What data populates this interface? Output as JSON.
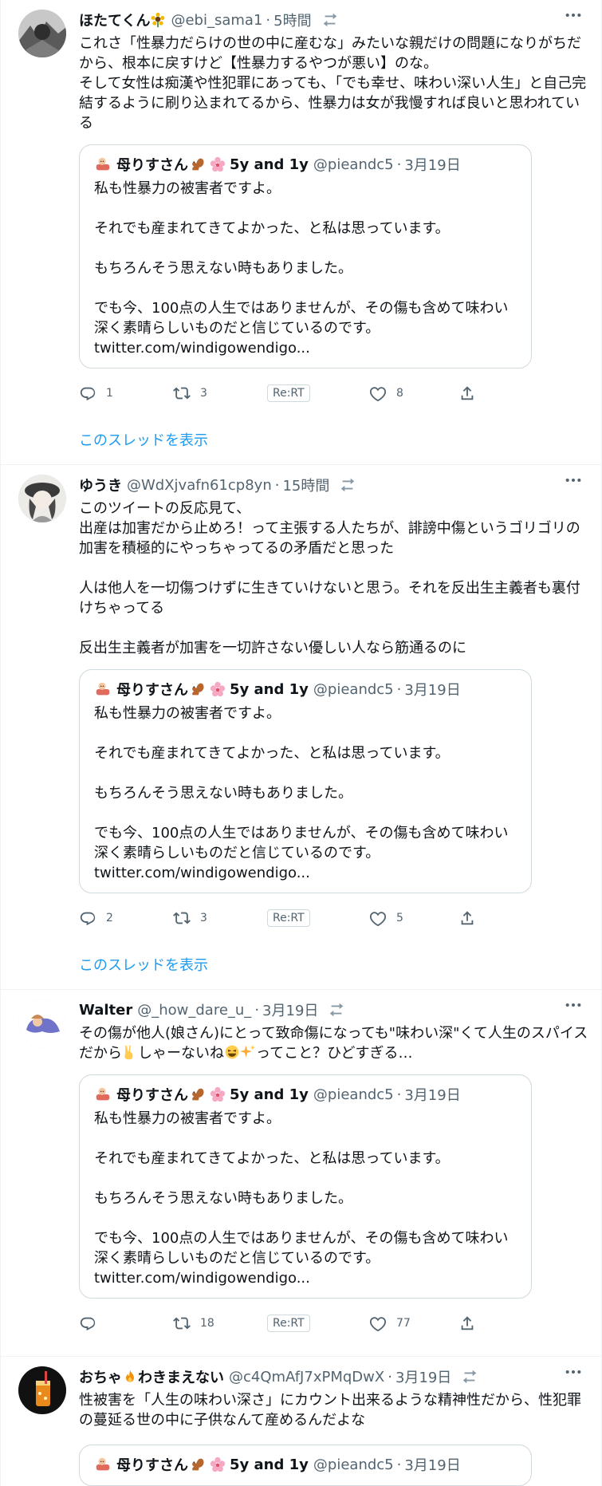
{
  "quote": {
    "name": "母りすさん",
    "tag": "5y and 1y",
    "handle": "@pieandc5",
    "time": "3月19日",
    "body": "私も性暴力の被害者ですよ。\n\nそれでも産まれてきてよかった、と私は思っています。\n\nもちろんそう思えない時もありました。\n\nでも今、100点の人生ではありませんが、その傷も含めて味わい深く素晴らしいものだと信じているのです。 ",
    "link": "twitter.com/windigowendigo..."
  },
  "labels": {
    "rert": "Re:RT",
    "show_thread": "このスレッドを表示",
    "dot": "·"
  },
  "tweets": [
    {
      "name": "ほたてくん",
      "handle": "@ebi_sama1",
      "time": "5時間",
      "body": "これさ「性暴力だらけの世の中に産むな」みたいな親だけの問題になりがちだから、根本に戻すけど【性暴力するやつが悪い】のな。\nそして女性は痴漢や性犯罪にあっても、「でも幸せ、味わい深い人生」と自己完結するように刷り込まれてるから、性暴力は女が我慢すれば良いと思われている",
      "replies": "1",
      "retweets": "3",
      "likes": "8"
    },
    {
      "name": "ゆうき",
      "handle": "@WdXjvafn61cp8yn",
      "time": "15時間",
      "body": "このツイートの反応見て、\n出産は加害だから止めろ！って主張する人たちが、誹謗中傷というゴリゴリの加害を積極的にやっちゃってるの矛盾だと思った\n\n人は他人を一切傷つけずに生きていけないと思う。それを反出生主義者も裏付けちゃってる\n\n反出生主義者が加害を一切許さない優しい人なら筋通るのに",
      "replies": "2",
      "retweets": "3",
      "likes": "5"
    },
    {
      "name": "Walter",
      "handle": "@_how_dare_u_",
      "time": "3月19日",
      "body_a": "その傷が他人(娘さん)にとって致命傷になっても\"味わい深\"くて人生のスパイスだから",
      "body_b": "しゃーないね",
      "body_c": "ってこと？ひどすぎる…",
      "replies": "",
      "retweets": "18",
      "likes": "77"
    },
    {
      "name_a": "おちゃ",
      "name_b": "わきまえない",
      "handle": "@c4QmAfJ7xPMqDwX",
      "time": "3月19日",
      "body": "性被害を「人生の味わい深さ」にカウント出来るような精神性だから、性犯罪の蔓延る世の中に子供なんて産めるんだよな"
    }
  ]
}
